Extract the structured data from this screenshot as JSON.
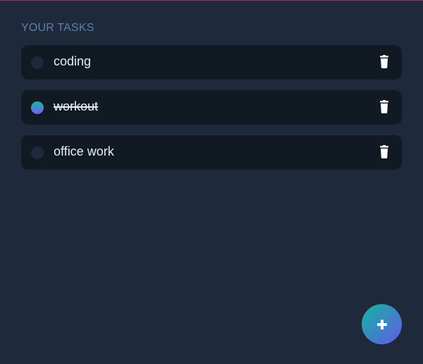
{
  "header": {
    "title": "YOUR TASKS"
  },
  "tasks": [
    {
      "label": "coding",
      "completed": false,
      "checkbox_icon": "empty-circle-icon",
      "delete_icon": "trash-icon"
    },
    {
      "label": "workout",
      "completed": true,
      "checkbox_icon": "checked-circle-icon",
      "delete_icon": "trash-icon"
    },
    {
      "label": "office work",
      "completed": false,
      "checkbox_icon": "empty-circle-icon",
      "delete_icon": "trash-icon"
    }
  ],
  "actions": {
    "add_icon": "plus-icon"
  },
  "colors": {
    "background": "#1e293b",
    "card": "#111923",
    "title": "#5f7fa9",
    "text": "#e7edf5",
    "gradient_start": "#10b7a0",
    "gradient_end": "#6657e8"
  }
}
